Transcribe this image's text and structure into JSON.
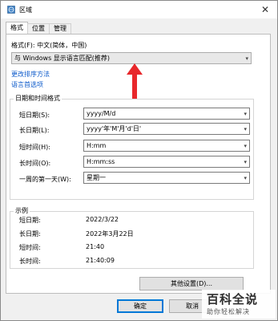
{
  "window": {
    "title": "区域",
    "close_symbol": "✕"
  },
  "tabs": [
    {
      "label": "格式",
      "active": true
    },
    {
      "label": "位置",
      "active": false
    },
    {
      "label": "管理",
      "active": false
    }
  ],
  "format": {
    "label": "格式(F): 中文(简体，中国)",
    "dropdown_value": "与 Windows 显示语言匹配(推荐)",
    "link_sort": "更改排序方法",
    "link_language": "语言首选项"
  },
  "datetime": {
    "group_title": "日期和时间格式",
    "rows": [
      {
        "label": "短日期(S):",
        "value": "yyyy/M/d"
      },
      {
        "label": "长日期(L):",
        "value": "yyyy'年'M'月'd'日'"
      },
      {
        "label": "短时间(H):",
        "value": "H:mm"
      },
      {
        "label": "长时间(O):",
        "value": "H:mm:ss"
      },
      {
        "label": "一周的第一天(W):",
        "value": "星期一"
      }
    ]
  },
  "examples": {
    "group_title": "示例",
    "rows": [
      {
        "label": "短日期:",
        "value": "2022/3/22"
      },
      {
        "label": "长日期:",
        "value": "2022年3月22日"
      },
      {
        "label": "短时间:",
        "value": "21:40"
      },
      {
        "label": "长时间:",
        "value": "21:40:09"
      }
    ]
  },
  "buttons": {
    "other_settings": "其他设置(D)...",
    "ok": "确定",
    "cancel": "取消"
  },
  "watermark": {
    "main": "百科全说",
    "sub": "助你轻松解决"
  },
  "colors": {
    "arrow": "#e8272b",
    "link": "#0a58ca",
    "default_button_border": "#0078d7"
  }
}
